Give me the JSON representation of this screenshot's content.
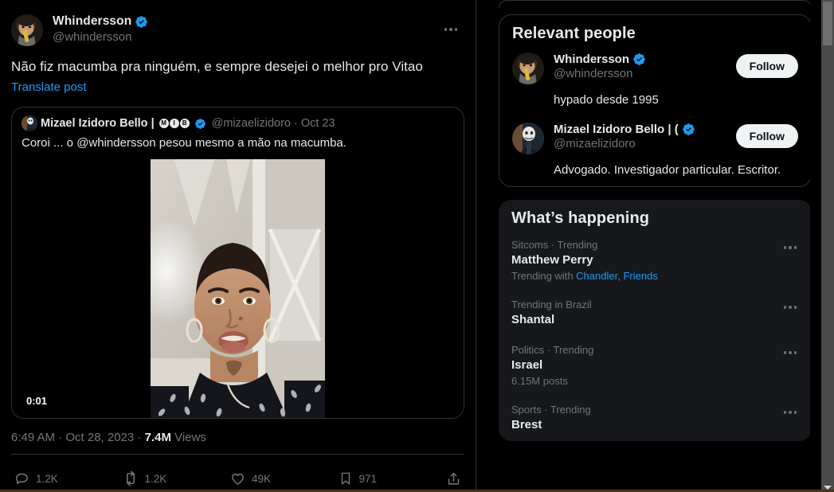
{
  "main_tweet": {
    "display_name": "Whindersson",
    "verified": true,
    "handle": "@whindersson",
    "text": "Não fiz macumba pra ninguém, e sempre desejei o melhor pro Vitao",
    "translate_label": "Translate post",
    "more_icon": "more-horizontal-icon",
    "timestamp": "6:49 AM · Oct 28, 2023 · ",
    "views_count": "7.4M",
    "views_label": " Views",
    "actions": [
      {
        "icon": "reply-icon",
        "label": "reply",
        "count": "1.2K"
      },
      {
        "icon": "retweet-icon",
        "label": "repost",
        "count": "1.2K"
      },
      {
        "icon": "heart-icon",
        "label": "like",
        "count": "49K"
      },
      {
        "icon": "bookmark-icon",
        "label": "bookmark",
        "count": "971"
      },
      {
        "icon": "share-icon",
        "label": "share",
        "count": ""
      }
    ]
  },
  "quoted_tweet": {
    "display_name": "Mizael Izidoro Bello |",
    "badge_letters": [
      "M",
      "I",
      "B"
    ],
    "verified": true,
    "handle": "@mizaelizidoro",
    "separator": "·",
    "date": "Oct 23",
    "text": "Coroi ... o @whindersson pesou mesmo a mão na macumba.",
    "video_duration": "0:01"
  },
  "sidebar": {
    "relevant_people": {
      "title": "Relevant people",
      "people": [
        {
          "name": "Whindersson",
          "verified": true,
          "handle": "@whindersson",
          "bio": "hypado desde 1995",
          "follow_label": "Follow"
        },
        {
          "name": "Mizael Izidoro Bello | (",
          "verified": true,
          "handle": "@mizaelizidoro",
          "bio": "Advogado. Investigador particular. Escritor.",
          "follow_label": "Follow"
        }
      ]
    },
    "whats_happening": {
      "title": "What’s happening",
      "trends": [
        {
          "category": "Sitcoms · Trending",
          "name": "Matthew Perry",
          "sub_prefix": "Trending with ",
          "sub_links": [
            "Chandler",
            "Friends"
          ],
          "sub_separator": ", ",
          "count": "",
          "more_icon": "more-horizontal-icon"
        },
        {
          "category": "Trending in Brazil",
          "name": "Shantal",
          "sub_prefix": "",
          "sub_links": [],
          "count": "",
          "more_icon": "more-horizontal-icon"
        },
        {
          "category": "Politics · Trending",
          "name": "Israel",
          "sub_prefix": "",
          "sub_links": [],
          "count": "6.15M posts",
          "more_icon": "more-horizontal-icon"
        },
        {
          "category": "Sports · Trending",
          "name": "Brest",
          "sub_prefix": "",
          "sub_links": [],
          "count": "",
          "more_icon": "more-horizontal-icon"
        }
      ]
    }
  },
  "colors": {
    "background": "#000000",
    "card_fill": "#16181c",
    "border": "#2f3336",
    "text_primary": "#e7e9ea",
    "text_secondary": "#71767b",
    "accent_blue": "#1d9bf0",
    "follow_button": "#eff3f4"
  }
}
